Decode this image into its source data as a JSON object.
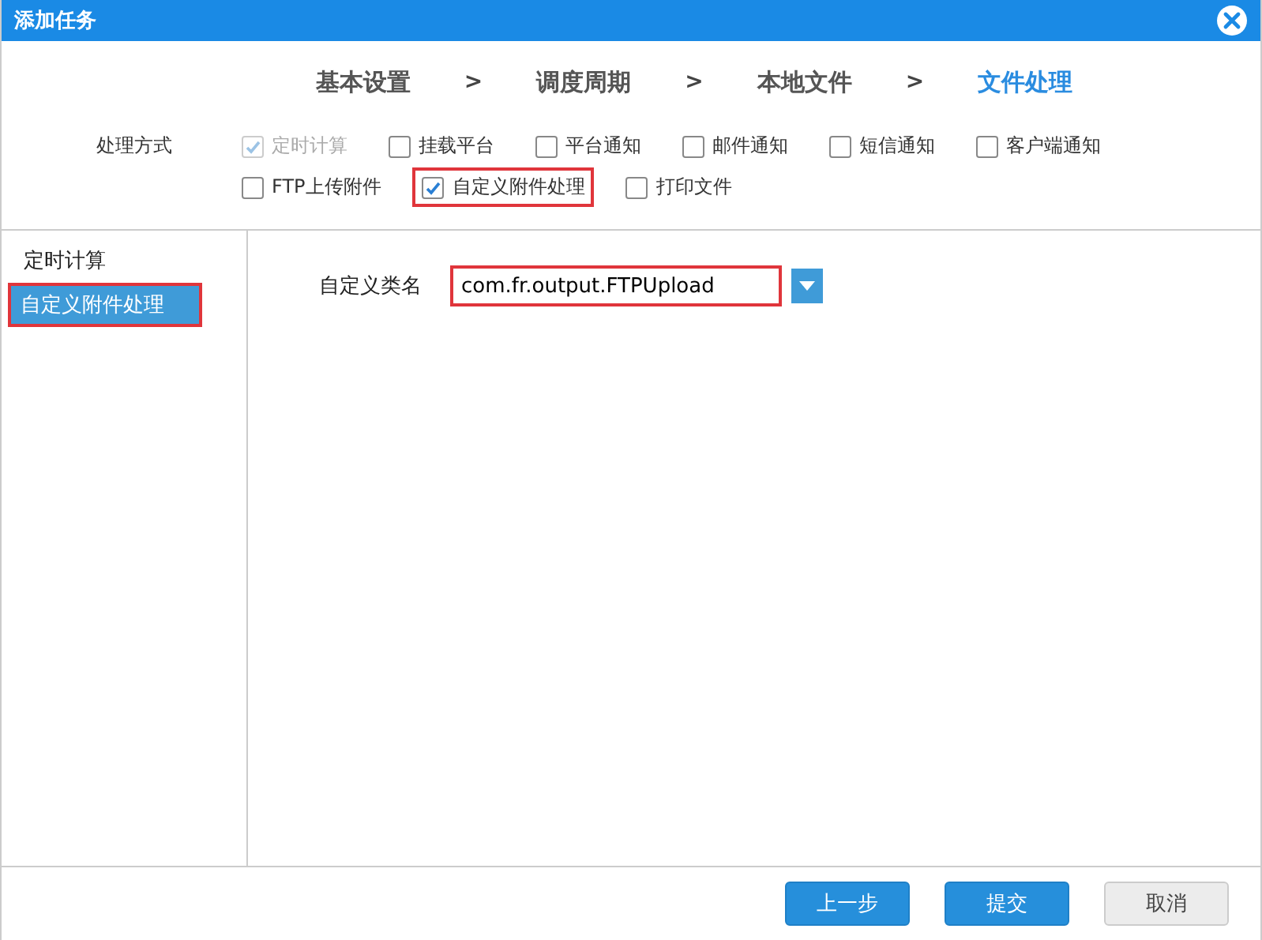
{
  "window": {
    "title": "添加任务"
  },
  "steps": [
    {
      "label": "基本设置",
      "selected": false
    },
    {
      "label": "调度周期",
      "selected": false
    },
    {
      "label": "本地文件",
      "selected": false
    },
    {
      "label": "文件处理",
      "selected": true
    }
  ],
  "step_separator": ">",
  "options": {
    "label": "处理方式",
    "items": [
      {
        "label": "定时计算",
        "checked": true,
        "disabled": true,
        "highlighted": false
      },
      {
        "label": "挂载平台",
        "checked": false,
        "disabled": false,
        "highlighted": false
      },
      {
        "label": "平台通知",
        "checked": false,
        "disabled": false,
        "highlighted": false
      },
      {
        "label": "邮件通知",
        "checked": false,
        "disabled": false,
        "highlighted": false
      },
      {
        "label": "短信通知",
        "checked": false,
        "disabled": false,
        "highlighted": false
      },
      {
        "label": "客户端通知",
        "checked": false,
        "disabled": false,
        "highlighted": false
      },
      {
        "label": "FTP上传附件",
        "checked": false,
        "disabled": false,
        "highlighted": false
      },
      {
        "label": "自定义附件处理",
        "checked": true,
        "disabled": false,
        "highlighted": true
      },
      {
        "label": "打印文件",
        "checked": false,
        "disabled": false,
        "highlighted": false
      }
    ]
  },
  "sidebar": {
    "items": [
      {
        "label": "定时计算",
        "selected": false,
        "highlighted": false
      },
      {
        "label": "自定义附件处理",
        "selected": true,
        "highlighted": true
      }
    ]
  },
  "form": {
    "label": "自定义类名",
    "value": "com.fr.output.FTPUpload",
    "highlighted": true
  },
  "buttons": [
    {
      "label": "上一步",
      "kind": "primary"
    },
    {
      "label": "提交",
      "kind": "primary"
    },
    {
      "label": "取消",
      "kind": "default"
    }
  ]
}
